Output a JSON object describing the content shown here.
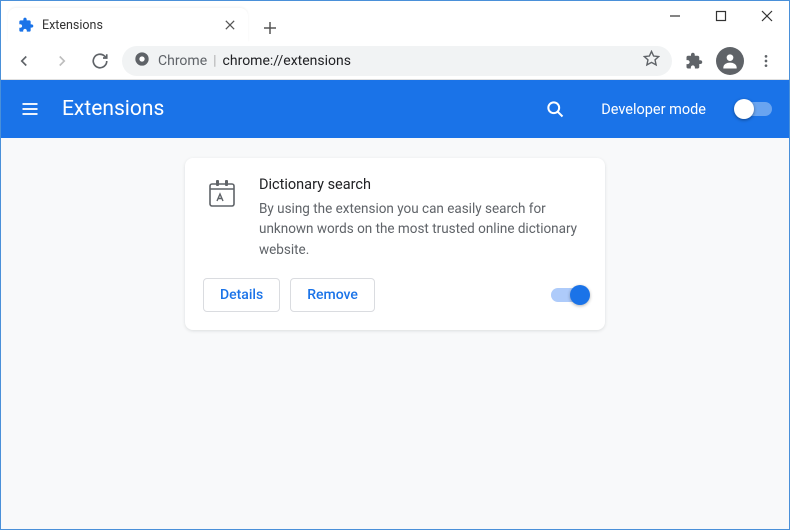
{
  "window": {
    "tab_title": "Extensions"
  },
  "omnibox": {
    "origin_label": "Chrome",
    "url": "chrome://extensions"
  },
  "header": {
    "title": "Extensions",
    "dev_mode_label": "Developer mode",
    "dev_mode_on": false
  },
  "extension": {
    "name": "Dictionary search",
    "description": "By using the extension you can easily search for unknown words on the most trusted online dictionary website.",
    "details_label": "Details",
    "remove_label": "Remove",
    "enabled": true
  }
}
